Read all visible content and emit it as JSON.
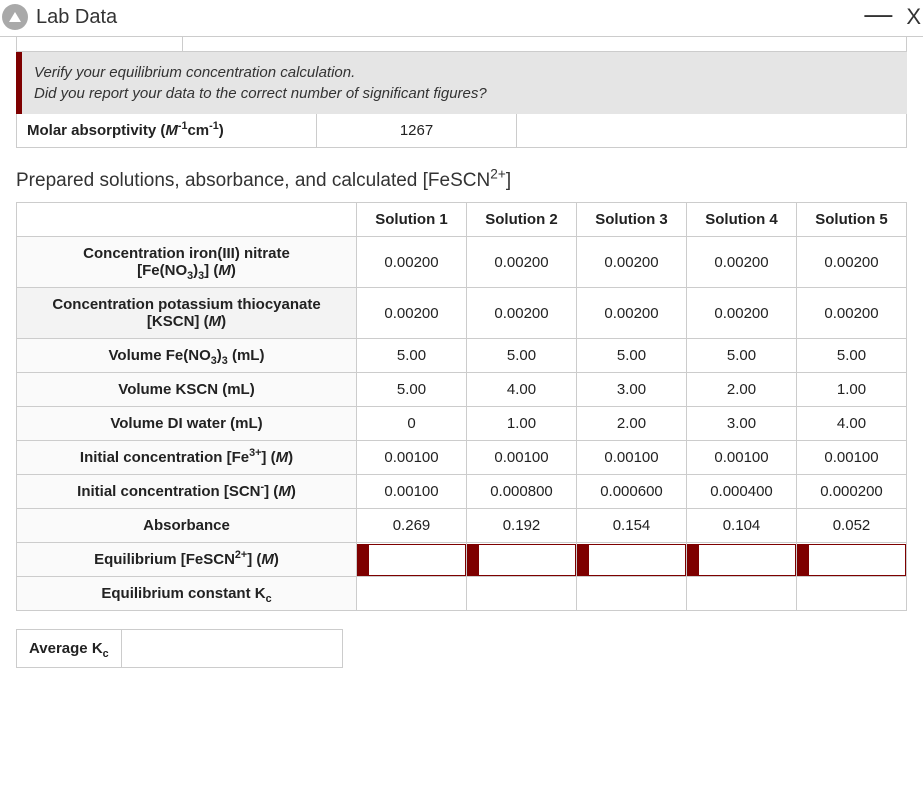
{
  "header": {
    "title": "Lab Data",
    "minimize": "—",
    "close": "X"
  },
  "alert": {
    "line1": "Verify your equilibrium concentration calculation.",
    "line2": "Did you report your data to the correct number of significant figures?"
  },
  "molar": {
    "label_pre": "Molar absorptivity (",
    "label_unit_M": "M",
    "label_sup1": "-1",
    "label_cm": "cm",
    "label_sup2": "-1",
    "label_post": ")",
    "value": "1267"
  },
  "section": {
    "pre": "Prepared solutions, absorbance, and calculated [FeSCN",
    "sup": "2+",
    "post": "]"
  },
  "columns": [
    "Solution 1",
    "Solution 2",
    "Solution 3",
    "Solution 4",
    "Solution 5"
  ],
  "rows": {
    "r0": {
      "label_parts": [
        "Concentration iron(III) nitrate",
        "[Fe(NO",
        "3",
        ")",
        "3",
        "] (",
        "M",
        ")"
      ],
      "vals": [
        "0.00200",
        "0.00200",
        "0.00200",
        "0.00200",
        "0.00200"
      ]
    },
    "r1": {
      "label_parts": [
        "Concentration potassium thiocyanate",
        "[KSCN] (",
        "M",
        ")"
      ],
      "vals": [
        "0.00200",
        "0.00200",
        "0.00200",
        "0.00200",
        "0.00200"
      ]
    },
    "r2": {
      "label": "Volume Fe(NO",
      "label_sub": "3",
      "label_post": ")",
      "label_sub2": "3",
      "label_end": " (mL)",
      "vals": [
        "5.00",
        "5.00",
        "5.00",
        "5.00",
        "5.00"
      ]
    },
    "r3": {
      "label": "Volume KSCN (mL)",
      "vals": [
        "5.00",
        "4.00",
        "3.00",
        "2.00",
        "1.00"
      ]
    },
    "r4": {
      "label": "Volume DI water (mL)",
      "vals": [
        "0",
        "1.00",
        "2.00",
        "3.00",
        "4.00"
      ]
    },
    "r5": {
      "label_pre": "Initial concentration [Fe",
      "label_sup": "3+",
      "label_mid": "] (",
      "label_M": "M",
      "label_post": ")",
      "vals": [
        "0.00100",
        "0.00100",
        "0.00100",
        "0.00100",
        "0.00100"
      ]
    },
    "r6": {
      "label_pre": "Initial concentration [SCN",
      "label_sup": "-",
      "label_mid": "] (",
      "label_M": "M",
      "label_post": ")",
      "vals": [
        "0.00100",
        "0.000800",
        "0.000600",
        "0.000400",
        "0.000200"
      ]
    },
    "r7": {
      "label": "Absorbance",
      "vals": [
        "0.269",
        "0.192",
        "0.154",
        "0.104",
        "0.052"
      ]
    },
    "r8": {
      "label_pre": "Equilibrium [FeSCN",
      "label_sup": "2+",
      "label_mid": "] (",
      "label_M": "M",
      "label_post": ")",
      "vals": [
        "",
        "",
        "",
        "",
        ""
      ]
    },
    "r9": {
      "label_pre": "Equilibrium constant K",
      "label_sub": "c",
      "vals": [
        "",
        "",
        "",
        "",
        ""
      ]
    }
  },
  "avg": {
    "label_pre": "Average K",
    "label_sub": "c",
    "value": ""
  }
}
